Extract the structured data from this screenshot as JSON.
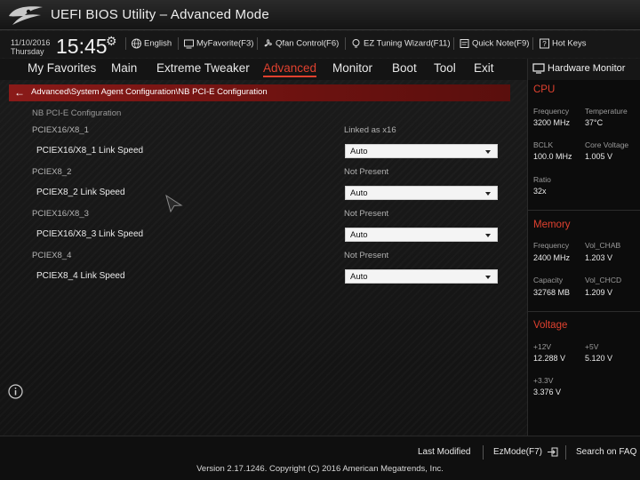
{
  "window": {
    "title": "UEFI BIOS Utility – Advanced Mode",
    "logo_icon": "rog-eye-logo"
  },
  "infobar": {
    "date": "11/10/2016",
    "day": "Thursday",
    "time": "15:45",
    "items": [
      {
        "label": "English",
        "icon": "globe-icon"
      },
      {
        "label": "MyFavorite(F3)",
        "icon": "favorite-icon"
      },
      {
        "label": "Qfan Control(F6)",
        "icon": "fan-icon"
      },
      {
        "label": "EZ Tuning Wizard(F11)",
        "icon": "bulb-icon"
      },
      {
        "label": "Quick Note(F9)",
        "icon": "note-icon"
      },
      {
        "label": "Hot Keys",
        "icon": "question-icon"
      }
    ]
  },
  "menu": {
    "items": [
      "My Favorites",
      "Main",
      "Extreme Tweaker",
      "Advanced",
      "Monitor",
      "Boot",
      "Tool",
      "Exit"
    ],
    "active": "Advanced"
  },
  "breadcrumb": "Advanced\\System Agent Configuration\\NB PCI-E Configuration",
  "content": {
    "section_title": "NB PCI-E Configuration",
    "groups": [
      {
        "name": "PCIEX16/X8_1",
        "status": "Linked as x16",
        "option_label": "PCIEX16/X8_1 Link Speed",
        "option_value": "Auto"
      },
      {
        "name": "PCIEX8_2",
        "status": "Not Present",
        "option_label": "PCIEX8_2 Link Speed",
        "option_value": "Auto"
      },
      {
        "name": "PCIEX16/X8_3",
        "status": "Not Present",
        "option_label": "PCIEX16/X8_3 Link Speed",
        "option_value": "Auto"
      },
      {
        "name": "PCIEX8_4",
        "status": "Not Present",
        "option_label": "PCIEX8_4 Link Speed",
        "option_value": "Auto"
      }
    ]
  },
  "hardware_monitor": {
    "title": "Hardware Monitor",
    "cpu": {
      "heading": "CPU",
      "frequency_label": "Frequency",
      "frequency": "3200 MHz",
      "temperature_label": "Temperature",
      "temperature": "37°C",
      "bclk_label": "BCLK",
      "bclk": "100.0 MHz",
      "core_voltage_label": "Core Voltage",
      "core_voltage": "1.005 V",
      "ratio_label": "Ratio",
      "ratio": "32x"
    },
    "memory": {
      "heading": "Memory",
      "frequency_label": "Frequency",
      "frequency": "2400 MHz",
      "vol_chab_label": "Vol_CHAB",
      "vol_chab": "1.203 V",
      "capacity_label": "Capacity",
      "capacity": "32768 MB",
      "vol_chcd_label": "Vol_CHCD",
      "vol_chcd": "1.209 V"
    },
    "voltage": {
      "heading": "Voltage",
      "v12_label": "+12V",
      "v12": "12.288 V",
      "v5_label": "+5V",
      "v5": "5.120 V",
      "v33_label": "+3.3V",
      "v33": "3.376 V"
    }
  },
  "footer": {
    "last_modified": "Last Modified",
    "ezmode": "EzMode(F7)",
    "search": "Search on FAQ",
    "copyright": "Version 2.17.1246. Copyright (C) 2016 American Megatrends, Inc."
  },
  "colors": {
    "accent": "#e0412f",
    "breadcrumb_bg": "#7a1614",
    "dropdown_bg": "#f4f4f4"
  }
}
